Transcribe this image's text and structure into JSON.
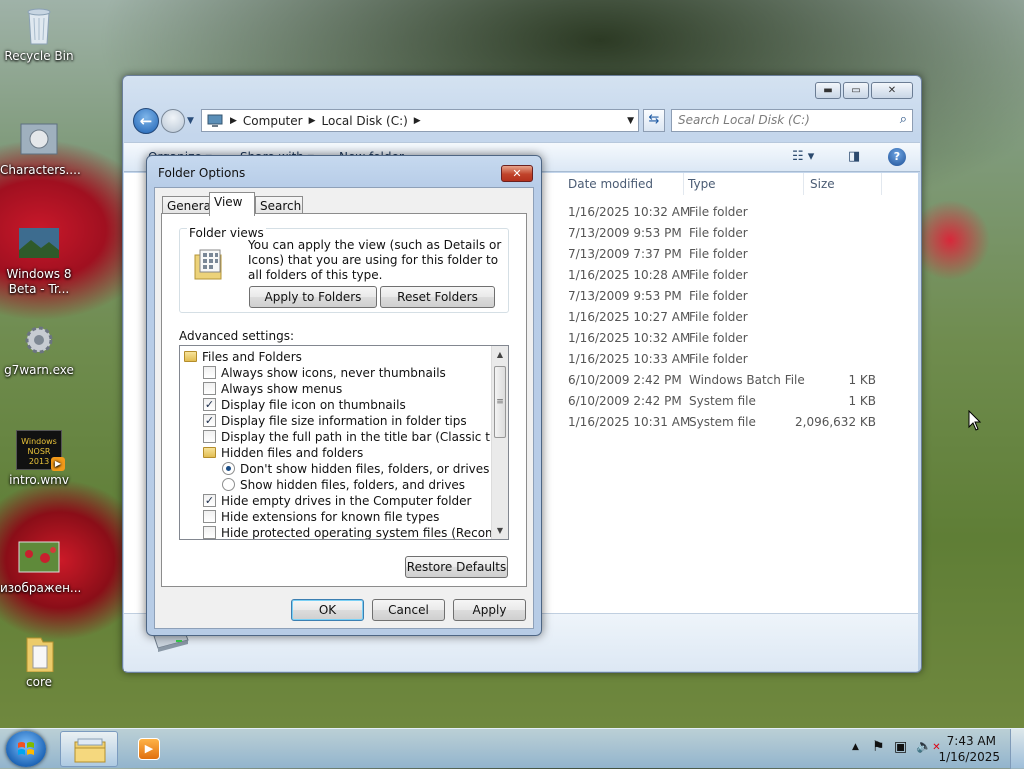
{
  "desktop": {
    "icons": [
      {
        "label": "Recycle Bin"
      },
      {
        "label": "Characters...."
      },
      {
        "label": "Windows 8 Beta - Tr..."
      },
      {
        "label": "g7warn.exe"
      },
      {
        "label": "intro.wmv"
      },
      {
        "label": "изображен..."
      },
      {
        "label": "core"
      }
    ],
    "intro_thumb_text": "Windows NOSR 2013"
  },
  "explorer": {
    "address": {
      "crumbs": [
        "Computer",
        "Local Disk (C:)"
      ]
    },
    "search_placeholder": "Search Local Disk (C:)",
    "commands": {
      "organize": "Organize ▾",
      "share": "Share with ▾",
      "new_folder": "New folder"
    },
    "columns": {
      "date": "Date modified",
      "type": "Type",
      "size": "Size"
    },
    "rows": [
      {
        "date": "1/16/2025 10:32 AM",
        "type": "File folder",
        "size": ""
      },
      {
        "date": "7/13/2009 9:53 PM",
        "type": "File folder",
        "size": ""
      },
      {
        "date": "7/13/2009 7:37 PM",
        "type": "File folder",
        "size": ""
      },
      {
        "date": "1/16/2025 10:28 AM",
        "type": "File folder",
        "size": ""
      },
      {
        "date": "7/13/2009 9:53 PM",
        "type": "File folder",
        "size": ""
      },
      {
        "date": "1/16/2025 10:27 AM",
        "type": "File folder",
        "size": ""
      },
      {
        "date": "1/16/2025 10:32 AM",
        "type": "File folder",
        "size": ""
      },
      {
        "date": "1/16/2025 10:33 AM",
        "type": "File folder",
        "size": ""
      },
      {
        "date": "6/10/2009 2:42 PM",
        "type": "Windows Batch File",
        "size": "1 KB"
      },
      {
        "date": "6/10/2009 2:42 PM",
        "type": "System file",
        "size": "1 KB"
      },
      {
        "date": "1/16/2025 10:31 AM",
        "type": "System file",
        "size": "2,096,632 KB"
      }
    ]
  },
  "dialog": {
    "title": "Folder Options",
    "tabs": [
      "General",
      "View",
      "Search"
    ],
    "folder_views": {
      "label": "Folder views",
      "description": "You can apply the view (such as Details or Icons) that you are using for this folder to all folders of this type.",
      "apply_btn": "Apply to Folders",
      "reset_btn": "Reset Folders"
    },
    "advanced_label": "Advanced settings:",
    "tree": [
      {
        "kind": "folder",
        "indent": 0,
        "label": "Files and Folders"
      },
      {
        "kind": "checkbox",
        "indent": 1,
        "checked": false,
        "label": "Always show icons, never thumbnails"
      },
      {
        "kind": "checkbox",
        "indent": 1,
        "checked": false,
        "label": "Always show menus"
      },
      {
        "kind": "checkbox",
        "indent": 1,
        "checked": true,
        "label": "Display file icon on thumbnails"
      },
      {
        "kind": "checkbox",
        "indent": 1,
        "checked": true,
        "label": "Display file size information in folder tips"
      },
      {
        "kind": "checkbox",
        "indent": 1,
        "checked": false,
        "label": "Display the full path in the title bar (Classic theme only)"
      },
      {
        "kind": "folder",
        "indent": 1,
        "label": "Hidden files and folders"
      },
      {
        "kind": "radio",
        "indent": 2,
        "checked": true,
        "label": "Don't show hidden files, folders, or drives"
      },
      {
        "kind": "radio",
        "indent": 2,
        "checked": false,
        "label": "Show hidden files, folders, and drives"
      },
      {
        "kind": "checkbox",
        "indent": 1,
        "checked": true,
        "label": "Hide empty drives in the Computer folder"
      },
      {
        "kind": "checkbox",
        "indent": 1,
        "checked": false,
        "label": "Hide extensions for known file types"
      },
      {
        "kind": "checkbox",
        "indent": 1,
        "checked": false,
        "label": "Hide protected operating system files (Recommended)"
      }
    ],
    "restore_btn": "Restore Defaults",
    "ok_btn": "OK",
    "cancel_btn": "Cancel",
    "apply_btn": "Apply"
  },
  "taskbar": {
    "time": "7:43 AM",
    "date": "1/16/2025"
  }
}
